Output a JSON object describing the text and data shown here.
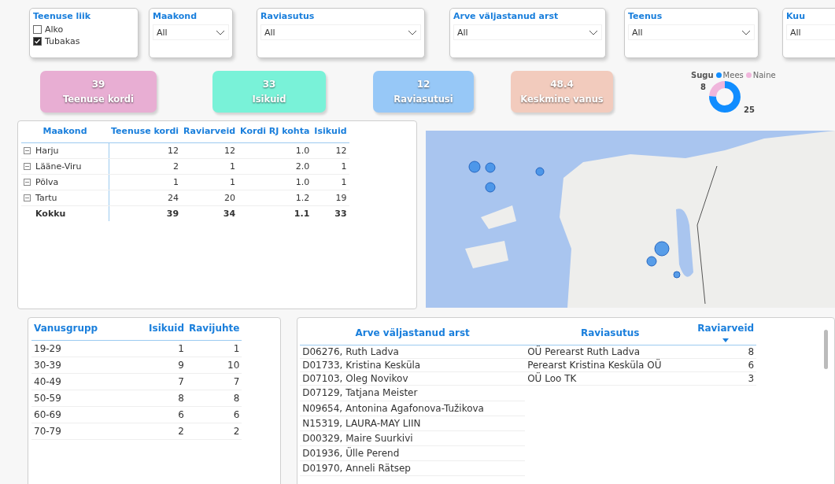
{
  "slicers": [
    {
      "kind": "checklist",
      "title": "Teenuse liik",
      "items": [
        {
          "label": "Alko",
          "checked": false
        },
        {
          "label": "Tubakas",
          "checked": true
        }
      ]
    },
    {
      "kind": "dropdown",
      "title": "Maakond",
      "value": "All"
    },
    {
      "kind": "dropdown",
      "title": "Raviasutus",
      "value": "All"
    },
    {
      "kind": "dropdown",
      "title": "Arve väljastanud arst",
      "value": "All"
    },
    {
      "kind": "dropdown",
      "title": "Teenus",
      "value": "All"
    },
    {
      "kind": "dropdown",
      "title": "Kuu",
      "value": "All"
    }
  ],
  "cards": [
    {
      "value": "39",
      "label": "Teenuse kordi",
      "color": "#e8aed3"
    },
    {
      "value": "33",
      "label": "Isikuid",
      "color": "#79f2d8"
    },
    {
      "value": "12",
      "label": "Raviasutusi",
      "color": "#97c8f7"
    },
    {
      "value": "48.4",
      "label": "Keskmine vanus",
      "color": "#f2cbbd"
    }
  ],
  "gender": {
    "chart_data": {
      "type": "donut",
      "legend": "top",
      "categories": [
        "Mees",
        "Naine"
      ],
      "colors": [
        "#118dff",
        "#f0b6dc"
      ],
      "series": [
        {
          "name": "Sugu",
          "values": [
            25,
            8
          ]
        }
      ],
      "data_labels": true
    }
  },
  "matrix": {
    "columns": [
      "Maakond",
      "Teenuse kordi",
      "Raviarveid",
      "Kordi RJ kohta",
      "Isikuid"
    ],
    "rows": [
      {
        "cells": [
          "Harju",
          "12",
          "12",
          "1.0",
          "12"
        ]
      },
      {
        "cells": [
          "Lääne-Viru",
          "2",
          "1",
          "2.0",
          "1"
        ]
      },
      {
        "cells": [
          "Põlva",
          "1",
          "1",
          "1.0",
          "1"
        ]
      },
      {
        "cells": [
          "Tartu",
          "24",
          "20",
          "1.2",
          "19"
        ]
      }
    ],
    "total": [
      "Kokku",
      "39",
      "34",
      "1.1",
      "33"
    ]
  },
  "age_table": {
    "columns": [
      "Vanusgrupp",
      "Isikuid",
      "Ravijuhte"
    ],
    "rows": [
      [
        "19-29",
        "1",
        "1"
      ],
      [
        "30-39",
        "9",
        "10"
      ],
      [
        "40-49",
        "7",
        "7"
      ],
      [
        "50-59",
        "8",
        "8"
      ],
      [
        "60-69",
        "6",
        "6"
      ],
      [
        "70-79",
        "2",
        "2"
      ]
    ]
  },
  "doctor_table": {
    "columns": [
      {
        "label": "Arve väljastanud arst",
        "sorted": false
      },
      {
        "label": "Raviasutus",
        "sorted": false
      },
      {
        "label": "Raviarveid",
        "sorted": true
      }
    ],
    "rows": [
      [
        "D06276, Ruth Ladva",
        "OÜ Perearst Ruth Ladva",
        "8"
      ],
      [
        "D01733, Kristina Kesküla",
        "Perearst Kristina Kesküla OÜ",
        "6"
      ],
      [
        "D07103, Oleg Novikov",
        "OÜ Loo TK",
        "3"
      ],
      [
        "D07129, Tatjana Meister"
      ],
      [
        "N09654, Antonina Agafonova-Tužikova"
      ],
      [
        "N15319, LAURA-MAY LIIN"
      ],
      [
        "D00329, Maire Suurkivi"
      ],
      [
        "D01936, Ülle Perend"
      ],
      [
        "D01970, Anneli Rätsep"
      ]
    ]
  }
}
